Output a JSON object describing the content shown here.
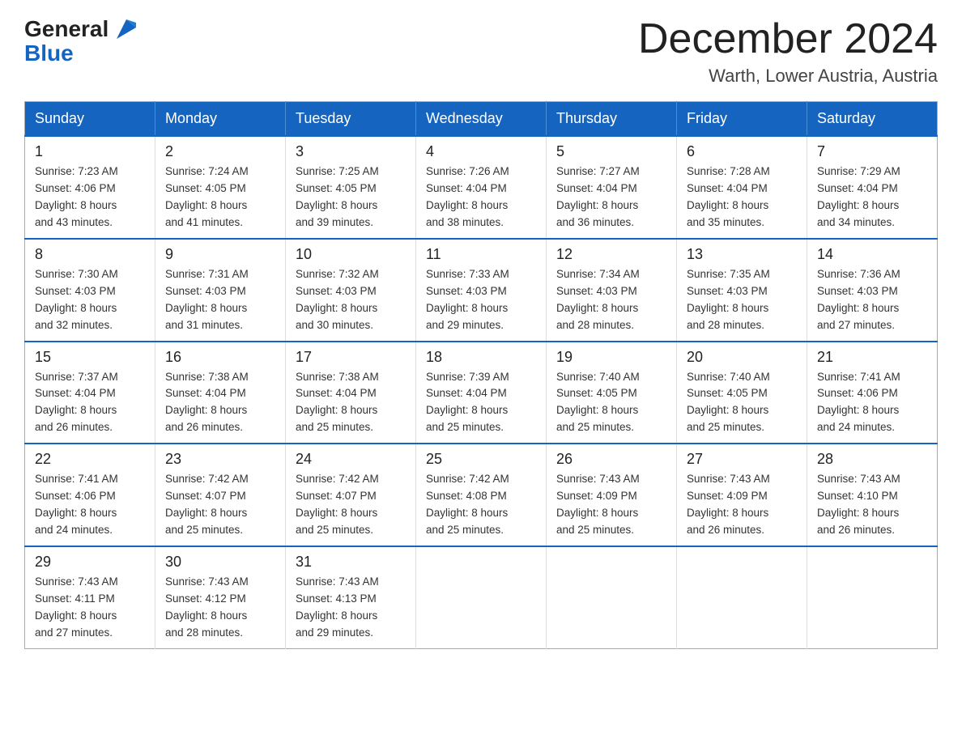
{
  "logo": {
    "general": "General",
    "blue": "Blue"
  },
  "title": "December 2024",
  "subtitle": "Warth, Lower Austria, Austria",
  "days_of_week": [
    "Sunday",
    "Monday",
    "Tuesday",
    "Wednesday",
    "Thursday",
    "Friday",
    "Saturday"
  ],
  "weeks": [
    [
      {
        "day": "1",
        "sunrise": "7:23 AM",
        "sunset": "4:06 PM",
        "daylight": "8 hours and 43 minutes."
      },
      {
        "day": "2",
        "sunrise": "7:24 AM",
        "sunset": "4:05 PM",
        "daylight": "8 hours and 41 minutes."
      },
      {
        "day": "3",
        "sunrise": "7:25 AM",
        "sunset": "4:05 PM",
        "daylight": "8 hours and 39 minutes."
      },
      {
        "day": "4",
        "sunrise": "7:26 AM",
        "sunset": "4:04 PM",
        "daylight": "8 hours and 38 minutes."
      },
      {
        "day": "5",
        "sunrise": "7:27 AM",
        "sunset": "4:04 PM",
        "daylight": "8 hours and 36 minutes."
      },
      {
        "day": "6",
        "sunrise": "7:28 AM",
        "sunset": "4:04 PM",
        "daylight": "8 hours and 35 minutes."
      },
      {
        "day": "7",
        "sunrise": "7:29 AM",
        "sunset": "4:04 PM",
        "daylight": "8 hours and 34 minutes."
      }
    ],
    [
      {
        "day": "8",
        "sunrise": "7:30 AM",
        "sunset": "4:03 PM",
        "daylight": "8 hours and 32 minutes."
      },
      {
        "day": "9",
        "sunrise": "7:31 AM",
        "sunset": "4:03 PM",
        "daylight": "8 hours and 31 minutes."
      },
      {
        "day": "10",
        "sunrise": "7:32 AM",
        "sunset": "4:03 PM",
        "daylight": "8 hours and 30 minutes."
      },
      {
        "day": "11",
        "sunrise": "7:33 AM",
        "sunset": "4:03 PM",
        "daylight": "8 hours and 29 minutes."
      },
      {
        "day": "12",
        "sunrise": "7:34 AM",
        "sunset": "4:03 PM",
        "daylight": "8 hours and 28 minutes."
      },
      {
        "day": "13",
        "sunrise": "7:35 AM",
        "sunset": "4:03 PM",
        "daylight": "8 hours and 28 minutes."
      },
      {
        "day": "14",
        "sunrise": "7:36 AM",
        "sunset": "4:03 PM",
        "daylight": "8 hours and 27 minutes."
      }
    ],
    [
      {
        "day": "15",
        "sunrise": "7:37 AM",
        "sunset": "4:04 PM",
        "daylight": "8 hours and 26 minutes."
      },
      {
        "day": "16",
        "sunrise": "7:38 AM",
        "sunset": "4:04 PM",
        "daylight": "8 hours and 26 minutes."
      },
      {
        "day": "17",
        "sunrise": "7:38 AM",
        "sunset": "4:04 PM",
        "daylight": "8 hours and 25 minutes."
      },
      {
        "day": "18",
        "sunrise": "7:39 AM",
        "sunset": "4:04 PM",
        "daylight": "8 hours and 25 minutes."
      },
      {
        "day": "19",
        "sunrise": "7:40 AM",
        "sunset": "4:05 PM",
        "daylight": "8 hours and 25 minutes."
      },
      {
        "day": "20",
        "sunrise": "7:40 AM",
        "sunset": "4:05 PM",
        "daylight": "8 hours and 25 minutes."
      },
      {
        "day": "21",
        "sunrise": "7:41 AM",
        "sunset": "4:06 PM",
        "daylight": "8 hours and 24 minutes."
      }
    ],
    [
      {
        "day": "22",
        "sunrise": "7:41 AM",
        "sunset": "4:06 PM",
        "daylight": "8 hours and 24 minutes."
      },
      {
        "day": "23",
        "sunrise": "7:42 AM",
        "sunset": "4:07 PM",
        "daylight": "8 hours and 25 minutes."
      },
      {
        "day": "24",
        "sunrise": "7:42 AM",
        "sunset": "4:07 PM",
        "daylight": "8 hours and 25 minutes."
      },
      {
        "day": "25",
        "sunrise": "7:42 AM",
        "sunset": "4:08 PM",
        "daylight": "8 hours and 25 minutes."
      },
      {
        "day": "26",
        "sunrise": "7:43 AM",
        "sunset": "4:09 PM",
        "daylight": "8 hours and 25 minutes."
      },
      {
        "day": "27",
        "sunrise": "7:43 AM",
        "sunset": "4:09 PM",
        "daylight": "8 hours and 26 minutes."
      },
      {
        "day": "28",
        "sunrise": "7:43 AM",
        "sunset": "4:10 PM",
        "daylight": "8 hours and 26 minutes."
      }
    ],
    [
      {
        "day": "29",
        "sunrise": "7:43 AM",
        "sunset": "4:11 PM",
        "daylight": "8 hours and 27 minutes."
      },
      {
        "day": "30",
        "sunrise": "7:43 AM",
        "sunset": "4:12 PM",
        "daylight": "8 hours and 28 minutes."
      },
      {
        "day": "31",
        "sunrise": "7:43 AM",
        "sunset": "4:13 PM",
        "daylight": "8 hours and 29 minutes."
      },
      null,
      null,
      null,
      null
    ]
  ],
  "labels": {
    "sunrise": "Sunrise:",
    "sunset": "Sunset:",
    "daylight": "Daylight:"
  }
}
